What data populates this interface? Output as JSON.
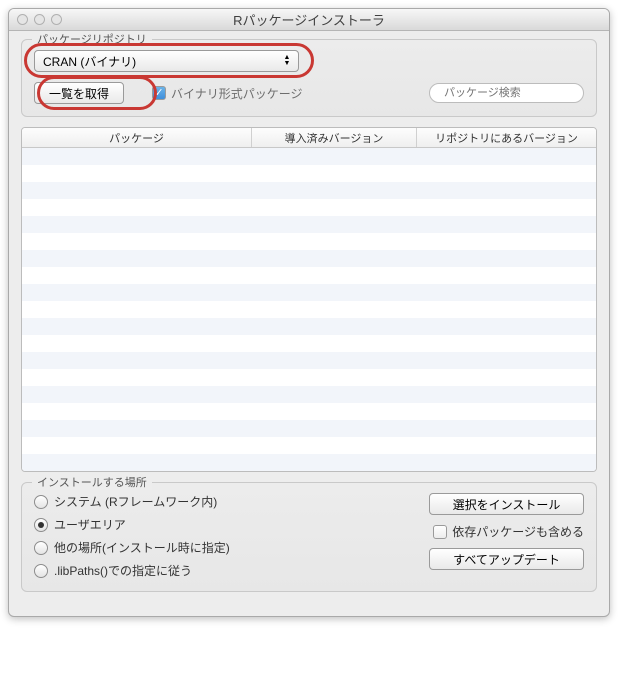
{
  "window": {
    "title": "Rパッケージインストーラ"
  },
  "repo": {
    "legend": "パッケージリポジトリ",
    "popup_value": "CRAN (バイナリ)",
    "get_list_button": "一覧を取得",
    "binary_checkbox_label": "バイナリ形式パッケージ",
    "binary_checked": true,
    "search_placeholder": "パッケージ検索"
  },
  "table": {
    "headers": {
      "package": "パッケージ",
      "installed": "導入済みバージョン",
      "repo_version": "リポジトリにあるバージョン"
    }
  },
  "install": {
    "legend": "インストールする場所",
    "radios": {
      "system": "システム (Rフレームワーク内)",
      "user": "ユーザエリア",
      "other": "他の場所(インストール時に指定)",
      "libpaths": ".libPaths()での指定に従う"
    },
    "install_selected": "選択をインストール",
    "deps_label": "依存パッケージも含める",
    "update_all": "すべてアップデート"
  }
}
